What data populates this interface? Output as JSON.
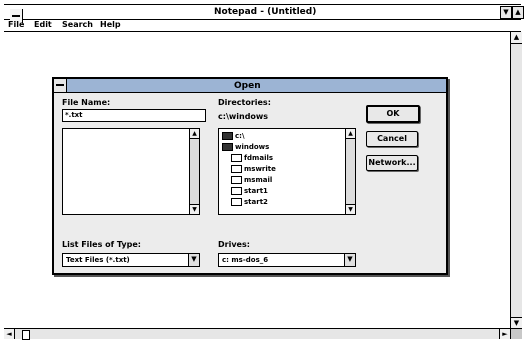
{
  "window": {
    "title": "Notepad - (Untitled)",
    "minimize_glyph": "▼",
    "maximize_glyph": "▲"
  },
  "menubar": {
    "items": [
      "File",
      "Edit",
      "Search",
      "Help"
    ]
  },
  "scrollbars": {
    "up": "▲",
    "down": "▼",
    "left": "◄",
    "right": "►"
  },
  "dialog": {
    "title": "Open",
    "file_name_label": "File Name:",
    "file_name_value": "*.txt",
    "directories_label": "Directories:",
    "current_dir": "c:\\windows",
    "directories": [
      {
        "name": "c:\\",
        "icon": "open-folder-icon"
      },
      {
        "name": "windows",
        "icon": "open-folder-icon"
      },
      {
        "name": "fdmails",
        "icon": "folder-icon"
      },
      {
        "name": "mswrite",
        "icon": "folder-icon"
      },
      {
        "name": "msmail",
        "icon": "folder-icon"
      },
      {
        "name": "start1",
        "icon": "folder-icon"
      },
      {
        "name": "start2",
        "icon": "folder-icon"
      }
    ],
    "list_types_label": "List Files of Type:",
    "list_types_value": "Text Files (*.txt)",
    "drives_label": "Drives:",
    "drives_value": "c: ms-dos_6",
    "buttons": {
      "ok": "OK",
      "cancel": "Cancel",
      "network": "Network..."
    },
    "combo_glyph": "▼"
  }
}
